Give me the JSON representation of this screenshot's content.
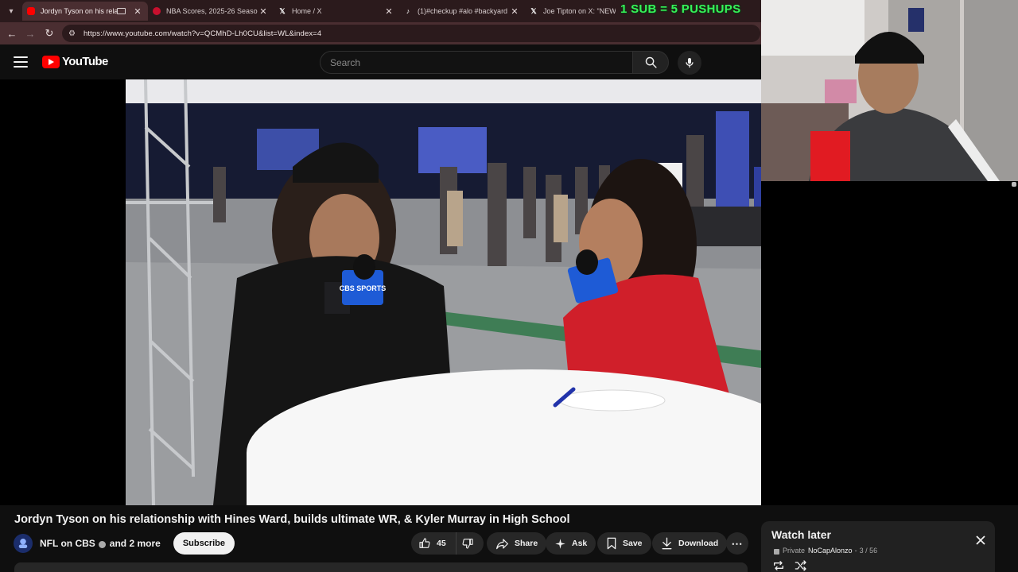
{
  "browser": {
    "tabs": [
      {
        "title": "Jordyn Tyson on his relatio",
        "favicon": "youtube-icon",
        "active": true
      },
      {
        "title": "NBA Scores, 2025-26 Season -",
        "favicon": "nba-icon",
        "active": false
      },
      {
        "title": "Home / X",
        "favicon": "x-icon",
        "active": false
      },
      {
        "title": "(1)#checkup #alo #backyard #",
        "favicon": "tiktok-icon",
        "active": false
      },
      {
        "title": "Joe Tipton on X: \"NEWS: US",
        "favicon": "x-icon",
        "active": false
      }
    ],
    "url": "https://www.youtube.com/watch?v=QCMhD-Lh0CU&list=WL&index=4"
  },
  "masthead": {
    "logo_text": "YouTube",
    "search_placeholder": "Search"
  },
  "stream_overlay": {
    "text": "1 SUB = 5 PUSHUPS",
    "color": "#38f25a"
  },
  "video": {
    "title": "Jordyn Tyson on his relationship with Hines Ward, builds ultimate WR, & Kyler Murray in High School",
    "channel": "NFL on CBS",
    "collaborators": "and 2 more",
    "subscribe_label": "Subscribe",
    "mic_flag_text": "CBS SPORTS",
    "likes": "45",
    "actions": {
      "share": "Share",
      "ask": "Ask",
      "save": "Save",
      "download": "Download"
    }
  },
  "watch_later": {
    "title": "Watch later",
    "privacy": "Private",
    "owner": "NoCapAlonzo",
    "position": "3 / 56"
  },
  "colors": {
    "youtube_red": "#ff0000",
    "browser_frame": "#4a2e31",
    "page_bg": "#0f0f0f",
    "cbs_blue": "#1e5bd6",
    "presenter_red": "#d01f2a"
  }
}
